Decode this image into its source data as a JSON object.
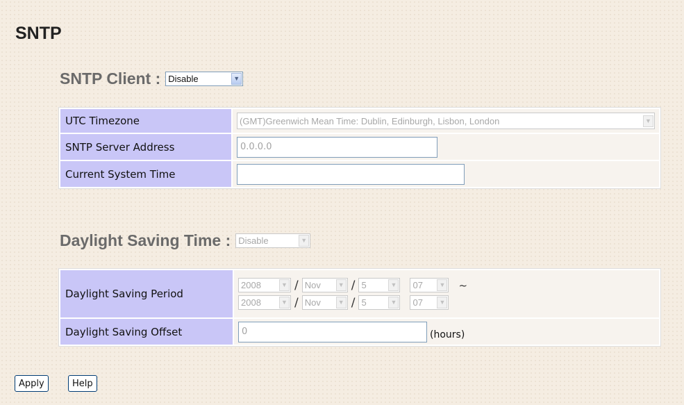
{
  "page_title": "SNTP",
  "sntp_client": {
    "label": "SNTP Client :",
    "value": "Disable"
  },
  "sntp_table": {
    "utc_timezone": {
      "label": "UTC Timezone",
      "value": "(GMT)Greenwich Mean Time: Dublin, Edinburgh, Lisbon, London"
    },
    "server_address": {
      "label": "SNTP Server Address",
      "value": "0.0.0.0"
    },
    "current_time": {
      "label": "Current System Time",
      "value": ""
    }
  },
  "daylight_saving": {
    "label": "Daylight Saving Time :",
    "value": "Disable"
  },
  "dst_table": {
    "period": {
      "label": "Daylight Saving Period",
      "start": {
        "year": "2008",
        "month": "Nov",
        "day": "5",
        "hour": "07"
      },
      "end": {
        "year": "2008",
        "month": "Nov",
        "day": "5",
        "hour": "07"
      },
      "separator": "/",
      "range_symbol": "~"
    },
    "offset": {
      "label": "Daylight Saving Offset",
      "value": "0",
      "unit": "(hours)"
    }
  },
  "buttons": {
    "apply": "Apply",
    "help": "Help"
  },
  "icons": {
    "dropdown": "chevron-down-icon"
  },
  "colors": {
    "label_cell": "#c9c6f7",
    "page_bg": "#f5ede2",
    "value_cell": "#f7f3ee"
  }
}
